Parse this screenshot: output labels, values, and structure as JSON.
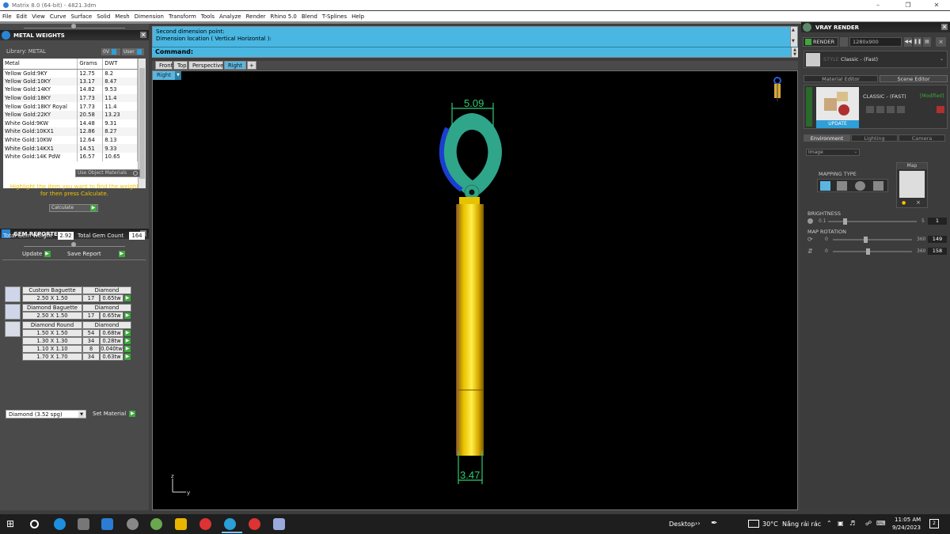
{
  "window": {
    "title": "Matrix 8.0 (64-bit) - 4821.3dm"
  },
  "menu": [
    "File",
    "Edit",
    "View",
    "Curve",
    "Surface",
    "Solid",
    "Mesh",
    "Dimension",
    "Transform",
    "Tools",
    "Analyze",
    "Render",
    "Rhino 5.0",
    "Blend",
    "T-Splines",
    "Help"
  ],
  "metal_weights": {
    "title": "METAL WEIGHTS",
    "library_label": "Library: METAL",
    "toggle_a": "0V",
    "toggle_b": "User",
    "columns": [
      "Metal",
      "Grams",
      "DWT"
    ],
    "rows": [
      [
        "Yellow Gold:9KY",
        "12.75",
        "8.2"
      ],
      [
        "Yellow Gold:10KY",
        "13.17",
        "8.47"
      ],
      [
        "Yellow Gold:14KY",
        "14.82",
        "9.53"
      ],
      [
        "Yellow Gold:18KY",
        "17.73",
        "11.4"
      ],
      [
        "Yellow Gold:18KY Royal",
        "17.73",
        "11.4"
      ],
      [
        "Yellow Gold:22KY",
        "20.58",
        "13.23"
      ],
      [
        "White Gold:9KW",
        "14.48",
        "9.31"
      ],
      [
        "White Gold:10KX1",
        "12.86",
        "8.27"
      ],
      [
        "White Gold:10KW",
        "12.64",
        "8.13"
      ],
      [
        "White Gold:14KX1",
        "14.51",
        "9.33"
      ],
      [
        "White Gold:14K PdW",
        "16.57",
        "10.65"
      ]
    ],
    "use_object_materials": "Use Object Materials",
    "hint": "Highlight the item you want to find the weight for then press Calculate.",
    "calculate_label": "Calculate"
  },
  "gem_reporter": {
    "title": "GEM REPORTER",
    "total_weight_label": "Total Gem Weight",
    "total_weight_value": "2.92",
    "total_count_label": "Total Gem Count",
    "total_count_value": "164",
    "update_label": "Update",
    "save_report_label": "Save Report",
    "groups": [
      {
        "name": "Custom Baguette",
        "material": "Diamond",
        "rows": [
          [
            "2.50 X 1.50",
            "17",
            "0.65tw"
          ]
        ]
      },
      {
        "name": "Diamond Baguette",
        "material": "Diamond",
        "rows": [
          [
            "2.50 X 1.50",
            "17",
            "0.65tw"
          ]
        ]
      },
      {
        "name": "Diamond Round",
        "material": "Diamond",
        "rows": [
          [
            "1.50 X 1.50",
            "54",
            "0.68tw"
          ],
          [
            "1.30 X 1.30",
            "34",
            "0.28tw"
          ],
          [
            "1.10 X 1.10",
            "8",
            "0.040tw"
          ],
          [
            "1.70 X 1.70",
            "34",
            "0.63tw"
          ]
        ]
      }
    ],
    "material_select": "Diamond   (3.52 spg)",
    "set_material_label": "Set Material"
  },
  "command": {
    "line1": "Second dimension point:",
    "line2": "Dimension location ( Vertical  Horizontal ):",
    "prompt": "Command:"
  },
  "viewport_tabs": [
    "Front",
    "Top",
    "Perspective",
    "Right"
  ],
  "active_view": "Right",
  "viewport": {
    "dim_top": "5.09",
    "dim_bottom": "3.47",
    "axis_z": "z",
    "axis_y": "y"
  },
  "vray": {
    "title": "VRAY RENDER",
    "render_label": "RENDER",
    "resolution": "1280x900",
    "style_label": "STYLE",
    "style_value": "Classic - (Fast)",
    "tab_material_editor": "Material Editor",
    "tab_scene_editor": "Scene Editor",
    "preset_name": "CLASSIC - (FAST)",
    "preset_state": "[Modified]",
    "update_label": "UPDATE",
    "env_tabs": [
      "Environment",
      "Lighting",
      "Camera"
    ],
    "env_select": "Image",
    "mapping_type_label": "MAPPING TYPE",
    "map_label": "Map",
    "brightness_label": "BRIGHTNESS",
    "brightness_min": "0.1",
    "brightness_max": "5",
    "brightness_value": "1",
    "brightness_level": 0.19,
    "map_rotation_label": "MAP ROTATION",
    "rot1_min": "0",
    "rot1_max": "360",
    "rot1_value": "149",
    "rot1_level": 0.41,
    "rot2_min": "0",
    "rot2_max": "360",
    "rot2_value": "158",
    "rot2_level": 0.44
  },
  "taskbar": {
    "desktop_label": "Desktop",
    "temperature": "30°C",
    "weather": "Nắng rải rác",
    "time": "11:05 AM",
    "date": "9/24/2023",
    "notifications": "2"
  },
  "colors": {
    "panel": "#4a4a4a",
    "command_bg": "#49b7e2",
    "green_button": "#3ea83e",
    "gold": "#e6b800",
    "bail_green": "#2fa58a",
    "dimension_green": "#2ecc71",
    "hint_text": "#f5c400"
  }
}
